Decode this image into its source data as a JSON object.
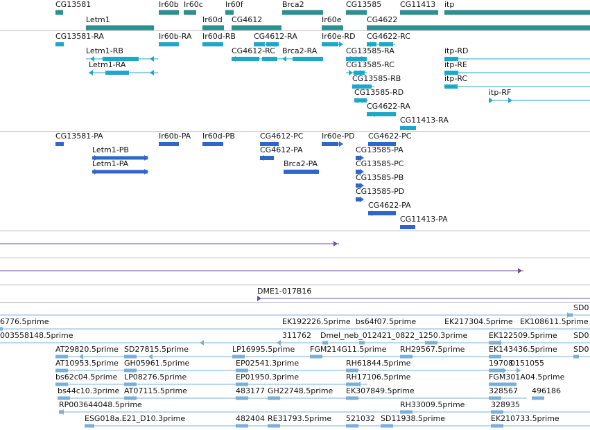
{
  "colors": {
    "gene": "#2e8f8f",
    "mrna": "#1ea8c8",
    "cds": "#2f66c8",
    "clone": "#6b4f9e",
    "est": "#7ab0d8",
    "separator": "#b8b8c4"
  },
  "tracks": {
    "genes": [
      {
        "label": "CG13581"
      },
      {
        "label": "Ir60b"
      },
      {
        "label": "Ir60c"
      },
      {
        "label": "Ir60f"
      },
      {
        "label": "Brca2"
      },
      {
        "label": "CG13585"
      },
      {
        "label": "CG11413"
      },
      {
        "label": "itp"
      },
      {
        "label": "Letm1"
      },
      {
        "label": "Ir60d"
      },
      {
        "label": "CG4612"
      },
      {
        "label": "Ir60e"
      },
      {
        "label": "CG4622"
      }
    ],
    "transcripts": [
      {
        "label": "CG13581-RA"
      },
      {
        "label": "Ir60b-RA"
      },
      {
        "label": "Ir60d-RB"
      },
      {
        "label": "CG4612-RA"
      },
      {
        "label": "Ir60e-RD"
      },
      {
        "label": "CG4622-RC"
      },
      {
        "label": "Letm1-RB"
      },
      {
        "label": "CG4612-RC"
      },
      {
        "label": "Brca2-RA"
      },
      {
        "label": "CG13585-RA"
      },
      {
        "label": "itp-RD"
      },
      {
        "label": "Letm1-RA"
      },
      {
        "label": "CG13585-RC"
      },
      {
        "label": "itp-RE"
      },
      {
        "label": "CG13585-RB"
      },
      {
        "label": "itp-RC"
      },
      {
        "label": "CG13585-RD"
      },
      {
        "label": "itp-RF"
      },
      {
        "label": "CG4622-RA"
      },
      {
        "label": "CG11413-RA"
      }
    ],
    "proteins": [
      {
        "label": "CG13581-PA"
      },
      {
        "label": "Ir60b-PA"
      },
      {
        "label": "Ir60d-PB"
      },
      {
        "label": "CG4612-PC"
      },
      {
        "label": "Ir60e-PD"
      },
      {
        "label": "CG4622-PC"
      },
      {
        "label": "Letm1-PB"
      },
      {
        "label": "CG4612-PA"
      },
      {
        "label": "CG13585-PA"
      },
      {
        "label": "Letm1-PA"
      },
      {
        "label": "Brca2-PA"
      },
      {
        "label": "CG13585-PC"
      },
      {
        "label": "CG13585-PB"
      },
      {
        "label": "CG13585-PD"
      },
      {
        "label": "CG4622-PA"
      },
      {
        "label": "CG11413-PA"
      }
    ],
    "clones": [
      {
        "label": "DME1-017B16"
      }
    ],
    "ests": [
      {
        "label": "SD0"
      },
      {
        "label": "6776.5prime"
      },
      {
        "label": "EK192226.5prime"
      },
      {
        "label": "bs64f07.5prime"
      },
      {
        "label": "EK217304.5prime"
      },
      {
        "label": "EK108611.5prime"
      },
      {
        "label": "003558148.5prime"
      },
      {
        "label": "311762"
      },
      {
        "label": "Dmel_neb_012421_0822_1250.3prime"
      },
      {
        "label": "EK122509.5prime"
      },
      {
        "label": "SD0"
      },
      {
        "label": "AT29820.5prime"
      },
      {
        "label": "SD27815.5prime"
      },
      {
        "label": "LP16995.5prime"
      },
      {
        "label": "FGM214G11.5prime"
      },
      {
        "label": "RH29567.5prime"
      },
      {
        "label": "EK143436.5prime"
      },
      {
        "label": "SD0"
      },
      {
        "label": "AT10953.5prime"
      },
      {
        "label": "GH05961.5prime"
      },
      {
        "label": "EP02541.3prime"
      },
      {
        "label": "RH61844.5prime"
      },
      {
        "label": "19708"
      },
      {
        "label": "0151055"
      },
      {
        "label": "bs62c04.5prime"
      },
      {
        "label": "LP08276.5prime"
      },
      {
        "label": "EP01950.3prime"
      },
      {
        "label": "RH17106.5prime"
      },
      {
        "label": "FGM301A04.5prime"
      },
      {
        "label": "bs44c10.3prime"
      },
      {
        "label": "AT07115.5prime"
      },
      {
        "label": "483177"
      },
      {
        "label": "GH22748.5prime"
      },
      {
        "label": "EK307849.5prime"
      },
      {
        "label": "328567"
      },
      {
        "label": "496186"
      },
      {
        "label": "RP003644048.5prime"
      },
      {
        "label": "RH33009.5prime"
      },
      {
        "label": "328935"
      },
      {
        "label": "ESG018a.E21_D10.3prime"
      },
      {
        "label": "482404"
      },
      {
        "label": "RE31793.5prime"
      },
      {
        "label": "521032"
      },
      {
        "label": "SD11938.5prime"
      },
      {
        "label": "EK210733.5prime"
      }
    ]
  }
}
